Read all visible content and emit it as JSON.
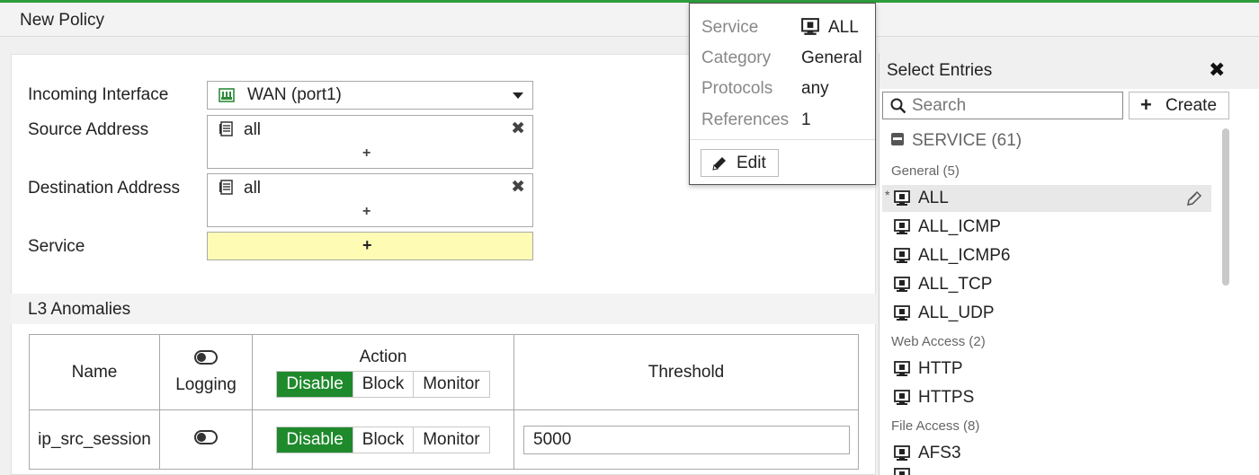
{
  "page": {
    "title": "New Policy"
  },
  "form": {
    "incoming_label": "Incoming Interface",
    "incoming_value": "WAN (port1)",
    "source_label": "Source Address",
    "source_value": "all",
    "destination_label": "Destination Address",
    "destination_value": "all",
    "service_label": "Service",
    "add_symbol": "+",
    "remove_symbol": "✖"
  },
  "section": {
    "title": "L3 Anomalies"
  },
  "table": {
    "headers": {
      "name": "Name",
      "logging": "Logging",
      "action": "Action",
      "threshold": "Threshold"
    },
    "action_options": [
      "Disable",
      "Block",
      "Monitor"
    ],
    "selected_action_header": "Disable",
    "rows": [
      {
        "name": "ip_src_session",
        "logging": false,
        "action": "Disable",
        "threshold": "5000"
      }
    ]
  },
  "popup": {
    "service_key": "Service",
    "service_val": "ALL",
    "category_key": "Category",
    "category_val": "General",
    "protocols_key": "Protocols",
    "protocols_val": "any",
    "references_key": "References",
    "references_val": "1",
    "edit_label": "Edit"
  },
  "panel": {
    "title": "Select Entries",
    "close_symbol": "✖",
    "search_placeholder": "Search",
    "create_label": "Create",
    "group_label": "SERVICE (61)",
    "categories": [
      {
        "label": "General (5)"
      },
      {
        "label": "Web Access (2)"
      },
      {
        "label": "File Access (8)"
      }
    ],
    "entries": [
      "ALL",
      "ALL_ICMP",
      "ALL_ICMP6",
      "ALL_TCP",
      "ALL_UDP",
      "HTTP",
      "HTTPS",
      "AFS3"
    ],
    "selected_marker": "*"
  },
  "colors": {
    "accent_green": "#1f8a2c",
    "top_line": "#2e9d3c",
    "service_field_bg": "#fdfbb4"
  },
  "icons": {
    "interface": "network-port-icon",
    "address": "address-book-icon",
    "service": "service-monitor-icon",
    "edit": "pencil-icon",
    "search": "search-icon",
    "group": "database-icon"
  }
}
